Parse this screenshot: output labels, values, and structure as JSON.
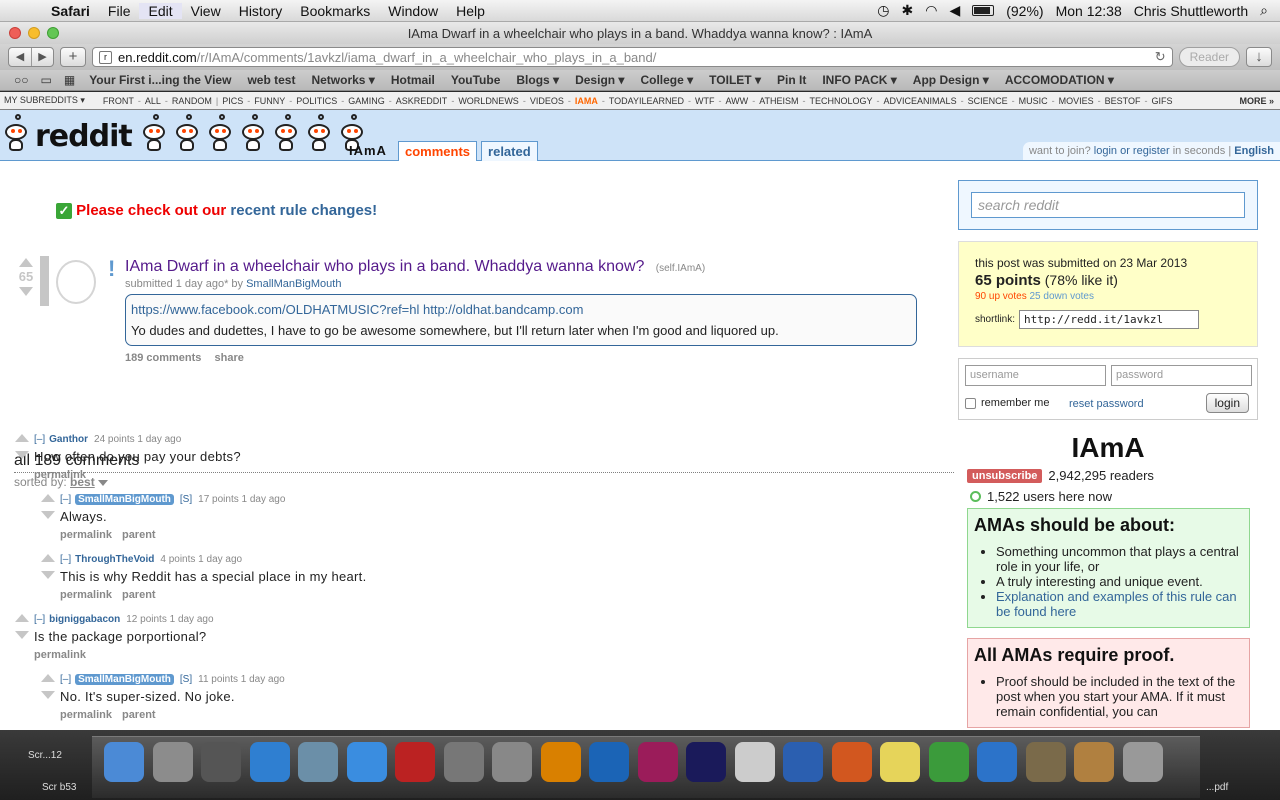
{
  "menubar": {
    "app": "Safari",
    "items": [
      "File",
      "Edit",
      "View",
      "History",
      "Bookmarks",
      "Window",
      "Help"
    ],
    "battery": "(92%)",
    "clock": "Mon 12:38",
    "user": "Chris Shuttleworth"
  },
  "window": {
    "title": "IAma Dwarf in a wheelchair who plays in a band. Whaddya wanna know? : IAmA"
  },
  "toolbar": {
    "url_host": "en.reddit.com",
    "url_path": "/r/IAmA/comments/1avkzl/iama_dwarf_in_a_wheelchair_who_plays_in_a_band/",
    "reader": "Reader"
  },
  "bookmarks": [
    "Your First i...ing the View",
    "web test",
    "Networks ▾",
    "Hotmail",
    "YouTube",
    "Blogs ▾",
    "Design ▾",
    "College ▾",
    "TOILET ▾",
    "Pin It",
    "INFO PACK ▾",
    "App Design ▾",
    "ACCOMODATION ▾"
  ],
  "srbar": {
    "my": "MY SUBREDDITS",
    "front": [
      "FRONT",
      "ALL",
      "RANDOM"
    ],
    "subs": [
      "PICS",
      "FUNNY",
      "POLITICS",
      "GAMING",
      "ASKREDDIT",
      "WORLDNEWS",
      "VIDEOS",
      "IAMA",
      "TODAYILEARNED",
      "WTF",
      "AWW",
      "ATHEISM",
      "TECHNOLOGY",
      "ADVICEANIMALS",
      "SCIENCE",
      "MUSIC",
      "MOVIES",
      "BESTOF",
      "GIFS"
    ],
    "more": "MORE »"
  },
  "header": {
    "logo": "reddit",
    "subreddit": "IAmA",
    "tab_comments": "comments",
    "tab_related": "related",
    "join": "want to join?",
    "login": "login or register",
    "seconds": "in seconds",
    "lang": "English"
  },
  "notice": {
    "red": "Please check out our",
    "link": "recent rule changes!"
  },
  "post": {
    "score": "65",
    "title": "IAma Dwarf in a wheelchair who plays in a band. Whaddya wanna know?",
    "domain": "(self.IAmA)",
    "submitted": "submitted 1 day ago* by",
    "author": "SmallManBigMouth",
    "links": "https://www.facebook.com/OLDHATMUSIC?ref=hl http://oldhat.bandcamp.com",
    "body": "Yo dudes and dudettes, I have to go be awesome somewhere, but I'll return later when I'm good and liquored up.",
    "comments_link": "189 comments",
    "share": "share"
  },
  "comments": {
    "header": "all 189 comments",
    "sorted_label": "sorted by:",
    "sorted_value": "best",
    "list": [
      {
        "author": "Ganthor",
        "meta": "24 points 1 day ago",
        "text": "How often do you pay your debts?",
        "btns": [
          "permalink"
        ],
        "op": false
      },
      {
        "author": "SmallManBigMouth",
        "meta": "17 points 1 day ago",
        "text": "Always.",
        "btns": [
          "permalink",
          "parent"
        ],
        "op": true
      },
      {
        "author": "ThroughTheVoid",
        "meta": "4 points 1 day ago",
        "text": "This is why Reddit has a special place in my heart.",
        "btns": [
          "permalink",
          "parent"
        ],
        "op": false
      },
      {
        "author": "bigniggabacon",
        "meta": "12 points 1 day ago",
        "text": "Is the package porportional?",
        "btns": [
          "permalink"
        ],
        "op": false
      },
      {
        "author": "SmallManBigMouth",
        "meta": "11 points 1 day ago",
        "text": "No. It's super-sized. No joke.",
        "btns": [
          "permalink",
          "parent"
        ],
        "op": true
      }
    ],
    "collapse": "[–]",
    "op_tag": "[S]"
  },
  "side": {
    "search_placeholder": "search reddit",
    "submitted": "this post was submitted on 23 Mar 2013",
    "points": "65 points",
    "like": "(78% like it)",
    "up": "90 up votes",
    "down": "25 down votes",
    "shortlink_label": "shortlink:",
    "shortlink": "http://redd.it/1avkzl",
    "username_ph": "username",
    "password_ph": "password",
    "remember": "remember me",
    "reset": "reset password",
    "login_btn": "login",
    "sr_title": "IAmA",
    "unsubscribe": "unsubscribe",
    "readers": "2,942,295 readers",
    "online": "1,522 users here now",
    "green_title": "AMAs should be about:",
    "green_items": [
      "Something uncommon that plays a central role in your life, or",
      "A truly interesting and unique event."
    ],
    "green_link": "Explanation and examples of this rule can be found here",
    "red_title": "All AMAs require proof.",
    "red_items": [
      "Proof should be included in the text of the post when you start your AMA. If it must remain confidential, you can"
    ]
  },
  "dock": {
    "left_label1": "Scr...12",
    "left_label2": "Scr b53",
    "right_label": "...pdf",
    "apps": [
      "Finder",
      "Launchpad",
      "Mission Control",
      "Safari",
      "iPhoto",
      "iTunes",
      "Photo Booth",
      "Preview",
      "System Preferences",
      "Illustrator",
      "Photoshop",
      "InDesign",
      "Audacity",
      "Font Book",
      "Word",
      "PowerPoint",
      "Stickies",
      "Chrome",
      "Xcode",
      "iPhoto Library",
      "Address Book",
      "Trash"
    ]
  }
}
